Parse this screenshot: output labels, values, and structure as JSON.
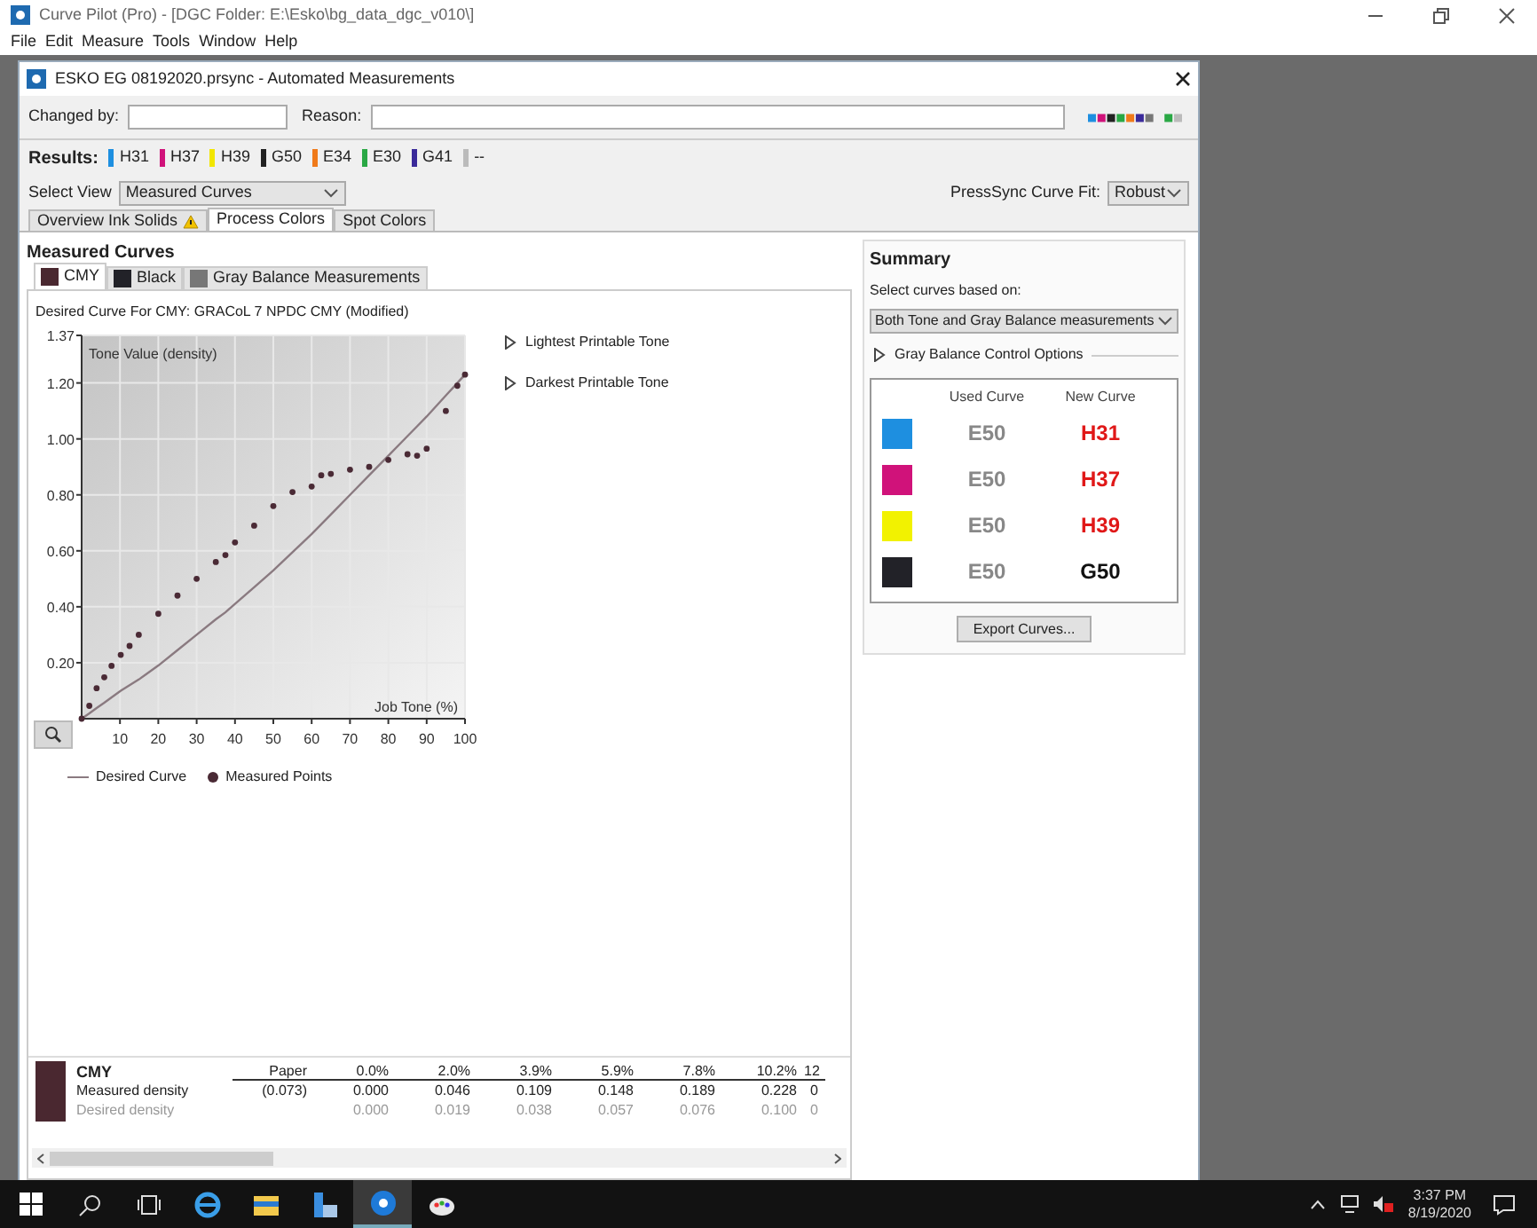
{
  "app": {
    "title": "Curve Pilot (Pro) - [DGC Folder: E:\\Esko\\bg_data_dgc_v010\\]",
    "menu": [
      "File",
      "Edit",
      "Measure",
      "Tools",
      "Window",
      "Help"
    ]
  },
  "dialog": {
    "title": "ESKO EG 08192020.prsync - Automated Measurements",
    "fields": [
      {
        "label": "Changed by:"
      },
      {
        "label": "Reason:"
      }
    ],
    "results": {
      "label": "Results:",
      "items": [
        {
          "label": "H31",
          "color": "#1e8fe0"
        },
        {
          "label": "H37",
          "color": "#d0127a"
        },
        {
          "label": "H39",
          "color": "#f2e600"
        },
        {
          "label": "G50",
          "color": "#222222"
        },
        {
          "label": "E34",
          "color": "#f07a1a"
        },
        {
          "label": "E30",
          "color": "#2aa845"
        },
        {
          "label": "G41",
          "color": "#3a2a9a"
        },
        {
          "label": "--",
          "color": "#bbbbbb"
        }
      ]
    },
    "select_view": {
      "label": "Select View",
      "value": "Measured Curves"
    },
    "curve_fit": {
      "label": "PressSync Curve Fit:",
      "value": "Robust"
    },
    "tabs": [
      {
        "label": "Overview Ink Solids",
        "warning": true,
        "selected": false
      },
      {
        "label": "Process Colors",
        "warning": false,
        "selected": true
      },
      {
        "label": "Spot Colors",
        "warning": false,
        "selected": false
      }
    ],
    "measured": {
      "title": "Measured Curves",
      "tabs": [
        {
          "label": "CMY",
          "color": "#4a2830",
          "selected": true
        },
        {
          "label": "Black",
          "color": "#222228",
          "selected": false
        },
        {
          "label": "Gray Balance Measurements",
          "color": "#777777",
          "selected": false
        }
      ],
      "caption": "Desired Curve For CMY:  GRACoL 7 NPDC CMY (Modified)",
      "chart_data": {
        "type": "line",
        "grid": true,
        "xlabel": "Job Tone (%)",
        "ylabel": "Tone Value (density)",
        "x": [
          0,
          2,
          3.9,
          5.9,
          7.8,
          10.2,
          12.5,
          14.9,
          20,
          25,
          30,
          35,
          37.5,
          40,
          45,
          50,
          55,
          60,
          62.5,
          65,
          70,
          75,
          80,
          85,
          87.5,
          90,
          95,
          98,
          100
        ],
        "series": [
          {
            "name": "Desired Curve",
            "color": "#8a7a80",
            "values": [
              0,
              0.019,
              0.038,
              0.057,
              0.076,
              0.1,
              0.12,
              0.14,
              0.19,
              0.245,
              0.3,
              0.355,
              0.38,
              0.41,
              0.47,
              0.53,
              0.595,
              0.66,
              0.695,
              0.73,
              0.8,
              0.87,
              0.94,
              1.01,
              1.045,
              1.08,
              1.155,
              1.2,
              1.23
            ]
          },
          {
            "name": "Measured Points",
            "type": "scatter",
            "color": "#4a2a35",
            "values": [
              0,
              0.046,
              0.109,
              0.148,
              0.189,
              0.228,
              0.26,
              0.3,
              0.375,
              0.44,
              0.5,
              0.56,
              0.585,
              0.63,
              0.69,
              0.76,
              0.81,
              0.83,
              0.87,
              0.875,
              0.89,
              0.9,
              0.925,
              0.945,
              0.94,
              0.965,
              1.1,
              1.19,
              1.23
            ]
          }
        ],
        "xlim": [
          0,
          100
        ],
        "ylim": [
          0,
          1.37
        ],
        "xticks": [
          10,
          20,
          30,
          40,
          50,
          60,
          70,
          80,
          90,
          100
        ],
        "yticks": [
          {
            "value": 0.2,
            "label": "0.20"
          },
          {
            "value": 0.4,
            "label": "0.40"
          },
          {
            "value": 0.6,
            "label": "0.60"
          },
          {
            "value": 0.8,
            "label": "0.80"
          },
          {
            "value": 1.0,
            "label": "1.00"
          },
          {
            "value": 1.2,
            "label": "1.20"
          },
          {
            "value": 1.37,
            "label": "1.37"
          }
        ]
      },
      "expanders": [
        {
          "label": "Lightest Printable Tone",
          "expanded": false
        },
        {
          "label": "Darkest Printable Tone",
          "expanded": false
        }
      ],
      "table": {
        "name": "CMY",
        "color": "#4a2830",
        "columns": [
          "Paper",
          "0.0%",
          "2.0%",
          "3.9%",
          "5.9%",
          "7.8%",
          "10.2%",
          "12"
        ],
        "rows": [
          {
            "label": "Measured density",
            "muted": false,
            "cells": [
              "(0.073)",
              "0.000",
              "0.046",
              "0.109",
              "0.148",
              "0.189",
              "0.228",
              "0"
            ]
          },
          {
            "label": "Desired density",
            "muted": true,
            "cells": [
              null,
              "0.000",
              "0.019",
              "0.038",
              "0.057",
              "0.076",
              "0.100",
              "0"
            ]
          }
        ]
      }
    },
    "summary": {
      "title": "Summary",
      "prompt": "Select curves based on:",
      "value": "Both Tone and Gray Balance measurements",
      "expander": {
        "label": "Gray Balance Control Options",
        "expanded": false
      },
      "headers": [
        "Used Curve",
        "New Curve"
      ],
      "rows": [
        {
          "color": "#1e8fe0",
          "used": "E50",
          "new": "H31",
          "changed": true
        },
        {
          "color": "#d0127a",
          "used": "E50",
          "new": "H37",
          "changed": true
        },
        {
          "color": "#f2f200",
          "used": "E50",
          "new": "H39",
          "changed": true
        },
        {
          "color": "#222228",
          "used": "E50",
          "new": "G50",
          "changed": false
        }
      ],
      "export": "Export Curves..."
    }
  },
  "taskbar": {
    "apps": [
      {
        "kind": "search",
        "selected": false
      },
      {
        "kind": "taskview",
        "selected": false
      },
      {
        "kind": "browser",
        "selected": false
      },
      {
        "kind": "folder",
        "selected": false
      },
      {
        "kind": "tool",
        "selected": false
      },
      {
        "kind": "curvepilot",
        "selected": true
      },
      {
        "kind": "paint",
        "selected": false
      }
    ],
    "time": "3:37 PM",
    "date": "8/19/2020"
  }
}
